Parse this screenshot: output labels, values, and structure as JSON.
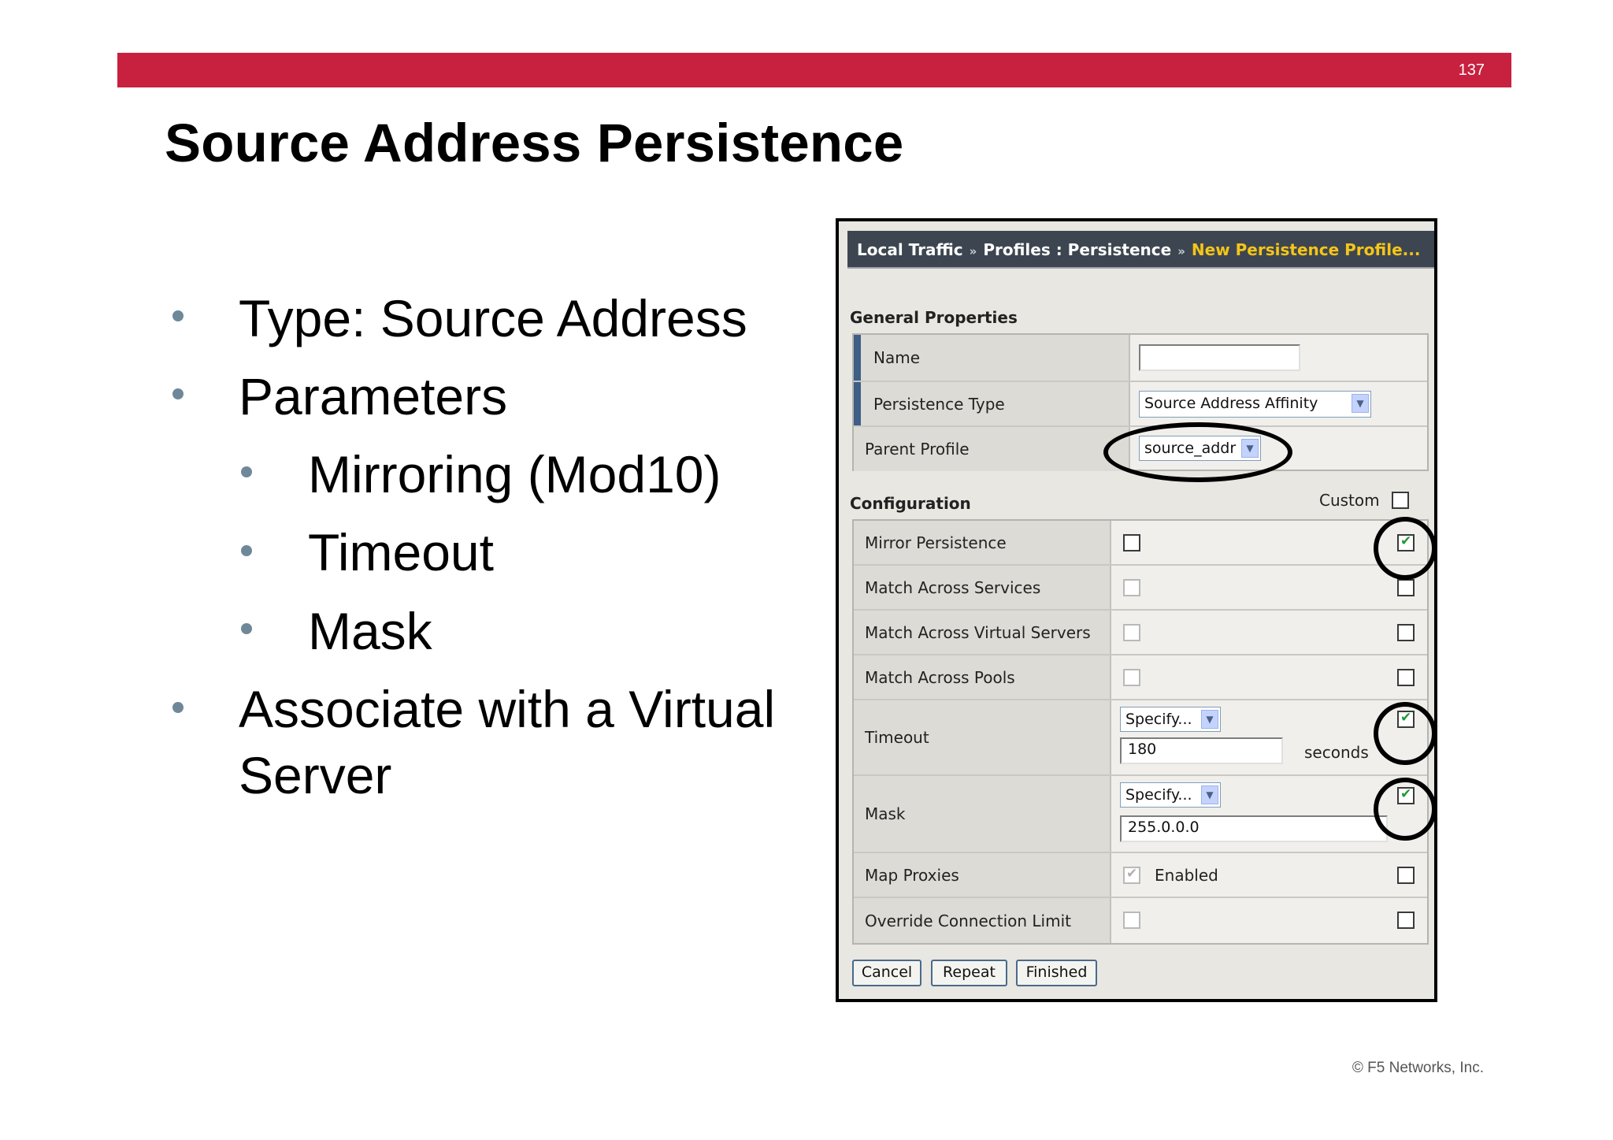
{
  "slide": {
    "page_number": "137",
    "title": "Source Address Persistence",
    "copyright": "© F5 Networks, Inc.",
    "bullets": [
      "Type:  Source Address",
      "Parameters",
      "Mirroring (Mod10)",
      "Timeout",
      "Mask",
      "Associate with a Virtual",
      "Server"
    ]
  },
  "breadcrumb": {
    "item1": "Local Traffic",
    "item2": "Profiles : Persistence",
    "item3": "New Persistence Profile...",
    "separator": "»"
  },
  "general": {
    "heading": "General Properties",
    "name_label": "Name",
    "name_value": "",
    "type_label": "Persistence Type",
    "type_value": "Source Address Affinity",
    "parent_label": "Parent Profile",
    "parent_value": "source_addr"
  },
  "config": {
    "heading": "Configuration",
    "custom_label": "Custom",
    "rows": {
      "mirror": "Mirror Persistence",
      "services": "Match Across Services",
      "virtuals": "Match Across Virtual Servers",
      "pools": "Match Across Pools",
      "timeout": "Timeout",
      "mask": "Mask",
      "proxies": "Map Proxies",
      "override": "Override Connection Limit"
    },
    "timeout_mode": "Specify...",
    "timeout_value": "180",
    "timeout_unit": "seconds",
    "mask_mode": "Specify...",
    "mask_value": "255.0.0.0",
    "proxies_value": "Enabled"
  },
  "buttons": {
    "cancel": "Cancel",
    "repeat": "Repeat",
    "finished": "Finished"
  },
  "colors": {
    "banner": "#c8203f",
    "breadcrumb_highlight": "#f5c518"
  }
}
